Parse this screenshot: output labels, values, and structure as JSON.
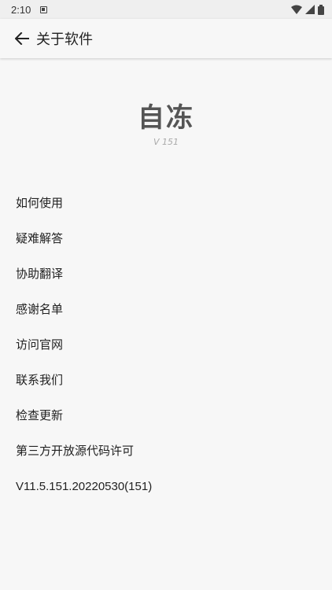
{
  "status_bar": {
    "time": "2:10",
    "icons": [
      "notification-icon",
      "wifi-icon",
      "cell-signal-icon",
      "battery-icon"
    ]
  },
  "app_bar": {
    "back_icon": "arrow-left-icon",
    "title": "关于软件"
  },
  "header": {
    "app_name": "自冻",
    "version_short": "V 151"
  },
  "menu": {
    "items": [
      {
        "label": "如何使用"
      },
      {
        "label": "疑难解答"
      },
      {
        "label": "协助翻译"
      },
      {
        "label": "感谢名单"
      },
      {
        "label": "访问官网"
      },
      {
        "label": "联系我们"
      },
      {
        "label": "检查更新"
      },
      {
        "label": "第三方开放源代码许可"
      }
    ],
    "version_full": "V11.5.151.20220530(151)"
  },
  "colors": {
    "background": "#f7f7f7",
    "status_bar": "#efefef",
    "app_name": "#555555",
    "version_short": "#aaaaaa"
  }
}
